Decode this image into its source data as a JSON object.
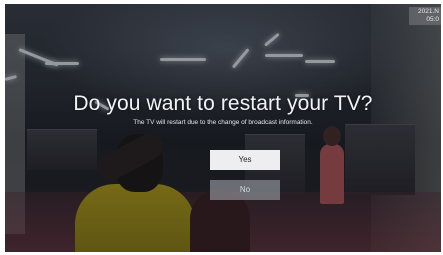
{
  "clock": {
    "line1": "2021.N",
    "line2": "05:0"
  },
  "dialog": {
    "title": "Do you want to restart your TV?",
    "message": "The TV will restart due to the change of broadcast information.",
    "yes_label": "Yes",
    "no_label": "No"
  }
}
